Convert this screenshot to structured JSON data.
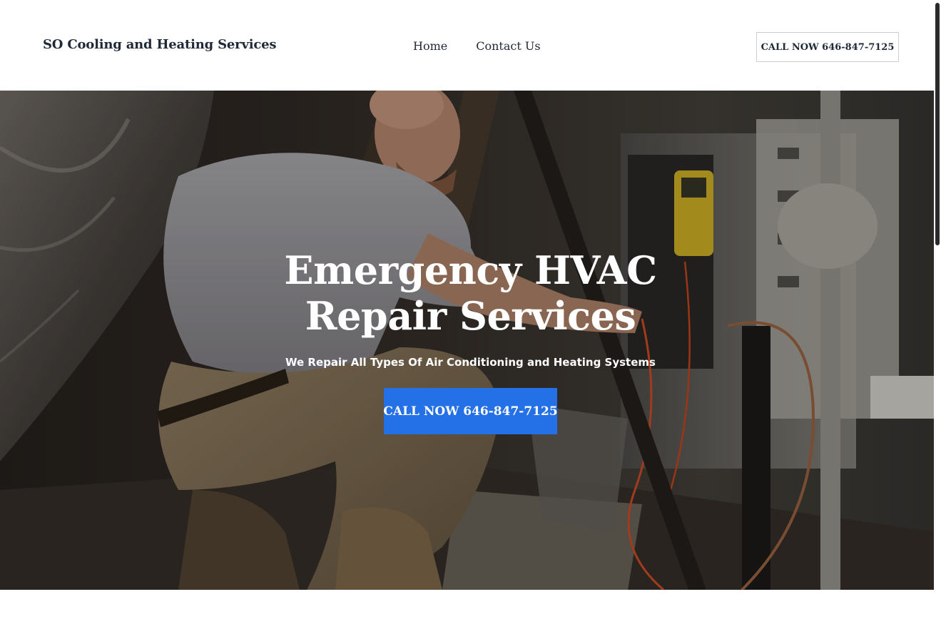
{
  "header": {
    "brand": "SO Cooling and Heating Services",
    "nav": [
      {
        "label": "Home"
      },
      {
        "label": "Contact Us"
      }
    ],
    "cta_label": "CALL NOW 646-847-7125"
  },
  "hero": {
    "title_line1": "Emergency HVAC",
    "title_line2": "Repair Services",
    "subtitle": "We Repair All Types Of Air Conditioning and Heating Systems",
    "cta_label": "CALL NOW 646-847-7125",
    "image_icon": "technician-photo"
  },
  "colors": {
    "accent": "#2470e6",
    "text_dark": "#1f2937",
    "hero_text": "#ffffff"
  }
}
